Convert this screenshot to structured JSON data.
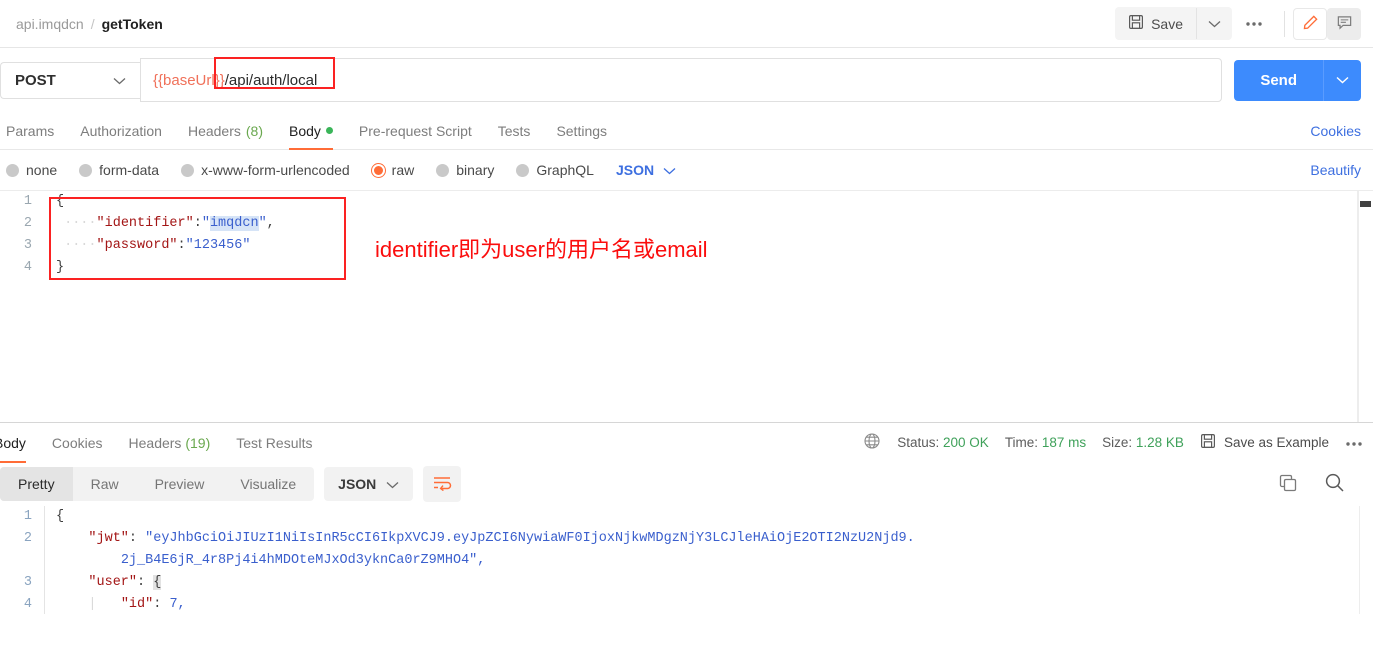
{
  "topbar": {
    "breadcrumb_collection": "api.imqdcn",
    "breadcrumb_separator": "/",
    "breadcrumb_request": "getToken",
    "save_label": "Save",
    "more_label": "000"
  },
  "url_bar": {
    "method": "POST",
    "variable": "{{baseUrl}}",
    "path": "/api/auth/local",
    "send_label": "Send"
  },
  "request_tabs": {
    "items": [
      {
        "label": "Params",
        "count": "",
        "active": false,
        "dot": false
      },
      {
        "label": "Authorization",
        "count": "",
        "active": false,
        "dot": false
      },
      {
        "label": "Headers",
        "count": "(8)",
        "active": false,
        "dot": false
      },
      {
        "label": "Body",
        "count": "",
        "active": true,
        "dot": true
      },
      {
        "label": "Pre-request Script",
        "count": "",
        "active": false,
        "dot": false
      },
      {
        "label": "Tests",
        "count": "",
        "active": false,
        "dot": false
      },
      {
        "label": "Settings",
        "count": "",
        "active": false,
        "dot": false
      }
    ],
    "cookies_link": "Cookies"
  },
  "body_type_row": {
    "options": [
      {
        "label": "none",
        "selected": false
      },
      {
        "label": "form-data",
        "selected": false
      },
      {
        "label": "x-www-form-urlencoded",
        "selected": false
      },
      {
        "label": "raw",
        "selected": true
      },
      {
        "label": "binary",
        "selected": false
      },
      {
        "label": "GraphQL",
        "selected": false
      }
    ],
    "format": "JSON",
    "beautify_link": "Beautify"
  },
  "request_body": {
    "lines": [
      {
        "n": "1",
        "open": "{"
      },
      {
        "n": "2",
        "key": "\"identifier\"",
        "colon": ":",
        "value": "\"imqdcn\"",
        "highlight": "imqdcn",
        "tail": ","
      },
      {
        "n": "3",
        "key": "\"password\"",
        "colon": ":",
        "value": "\"123456\"",
        "tail": ""
      },
      {
        "n": "4",
        "open": "}"
      }
    ],
    "annotation": "identifier即为user的用户名或email"
  },
  "response_tabs": {
    "items": [
      {
        "label": "Body",
        "count": "",
        "active": true
      },
      {
        "label": "Cookies",
        "count": "",
        "active": false
      },
      {
        "label": "Headers",
        "count": "(19)",
        "active": false
      },
      {
        "label": "Test Results",
        "count": "",
        "active": false
      }
    ]
  },
  "response_meta": {
    "status_label": "Status:",
    "status_value": "200 OK",
    "time_label": "Time:",
    "time_value": "187 ms",
    "size_label": "Size:",
    "size_value": "1.28 KB",
    "save_example_label": "Save as Example",
    "more_label": "000"
  },
  "response_toolbar": {
    "views": [
      {
        "label": "Pretty",
        "active": true
      },
      {
        "label": "Raw",
        "active": false
      },
      {
        "label": "Preview",
        "active": false
      },
      {
        "label": "Visualize",
        "active": false
      }
    ],
    "format": "JSON"
  },
  "response_body": {
    "lines": [
      {
        "n": "1",
        "text": "{"
      },
      {
        "n": "2",
        "key": "\"jwt\"",
        "value_start": "\"eyJhbGciOiJIUzI1NiIsInR5cCI6IkpXVCJ9.eyJpZCI6NywiaWF0IjoxNjkwMDgzNjY3LCJleHAiOjE2OTI2NzU2Njd9."
      },
      {
        "n": "",
        "value_cont": "2j_B4E6jR_4r8Pj4i4hMDOteMJxOd3yknCa0rZ9MHO4\","
      },
      {
        "n": "3",
        "key": "\"user\"",
        "brace": "{"
      },
      {
        "n": "4",
        "key": "\"id\"",
        "value": "7,"
      }
    ]
  },
  "colors": {
    "accent_orange": "#ff6c37",
    "send_blue": "#3d8bfd",
    "link_blue": "#3d6fe0",
    "status_green": "#3fa15a",
    "annotation_red": "#fb0d0d"
  }
}
